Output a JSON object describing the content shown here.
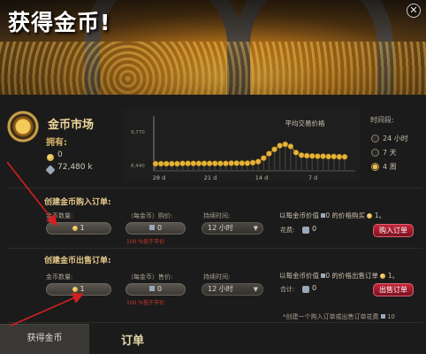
{
  "banner": {
    "title": "获得金币!"
  },
  "market": {
    "title": "金币市场",
    "own_label": "拥有:",
    "gold": "0",
    "gems": "72,480 k"
  },
  "chart_data": {
    "type": "line",
    "title": "平均交易价格",
    "y_tick_labels": [
      "9,770",
      "8,440"
    ],
    "x_tick_labels": [
      "28 d",
      "21 d",
      "14 d",
      "7 d"
    ],
    "ylim": [
      8440,
      9770
    ],
    "series": [
      {
        "values": [
          8440,
          8440,
          8440,
          8440,
          8440,
          8450,
          8450,
          8450,
          8450,
          8450,
          8450,
          8450,
          8450,
          8450,
          8460,
          8460,
          8460,
          8460,
          8480,
          8520,
          8650,
          8820,
          8980,
          9120,
          9170,
          9090,
          8860,
          8760,
          8740,
          8730,
          8720,
          8720,
          8710,
          8710,
          8700,
          8700
        ]
      }
    ]
  },
  "time_range": {
    "label": "时间段:",
    "options": [
      "24 小时",
      "7 天",
      "4 周"
    ],
    "selected": "4 周"
  },
  "buy": {
    "section_title": "创建金币购入订单:",
    "qty_label": "金币数量:",
    "qty_value": "1",
    "price_label": "（每金币）购价:",
    "price_value": "0",
    "duration_label": "持续时间:",
    "duration_value": "12 小时",
    "error": "100 %低于市价",
    "info_prefix": "以每金币价值",
    "info_mid": "0 的价格购买",
    "info_suffix": "1。",
    "cost_label": "花费:",
    "cost_value": "0",
    "button": "购入订单"
  },
  "sell": {
    "section_title": "创建金币出售订单:",
    "qty_label": "金币数量:",
    "qty_value": "1",
    "price_label": "（每金币）售价:",
    "price_value": "0",
    "duration_label": "持续时间:",
    "duration_value": "12 小时",
    "error": "100 %低于市价",
    "info_prefix": "以每金币价值",
    "info_mid": "0 的价格出售订单",
    "info_suffix": "1。",
    "total_label": "合计:",
    "total_value": "0",
    "button": "出售订单"
  },
  "footnote": "*创建一个购入订单或出售订单花费",
  "footnote_value": "10",
  "tabs": {
    "gold": "获得金币",
    "orders": "订单"
  },
  "colors": {
    "accent_red": "#c4283a",
    "gold": "#f0c050",
    "arrow_red": "#d02020"
  }
}
